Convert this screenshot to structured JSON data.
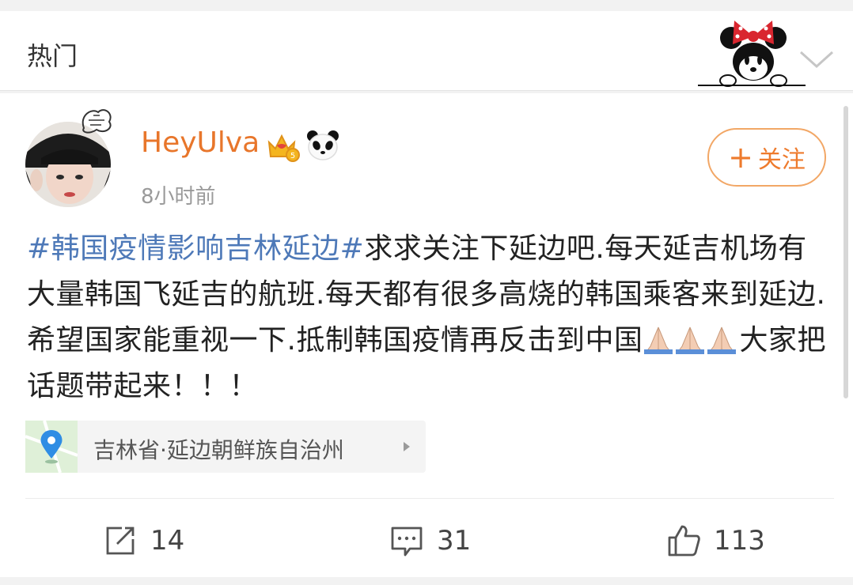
{
  "header": {
    "title": "热门"
  },
  "post": {
    "username": "HeyUlva",
    "time": "8小时前",
    "follow_label": "关注",
    "hashtag": "#韩国疫情影响吉林延边#",
    "body_part1": "求求关注下延边吧.每天延吉机场有大量韩国飞延吉的航班.每天都有很多高烧的韩国乘客来到延边.希望国家能重视一下.抵制韩国疫情再反击到中国",
    "body_part2": "大家把话题带起来！！！",
    "location": "吉林省·延边朝鲜族自治州",
    "reposts": "14",
    "comments": "31",
    "likes": "113"
  },
  "icons": {
    "crown_badge": "crown-badge-icon",
    "panda_badge": "panda-icon",
    "pray_emoji": "praying-hands-emoji",
    "location_pin": "location-pin-icon",
    "repost": "repost-icon",
    "comment": "comment-icon",
    "like": "thumbs-up-icon"
  },
  "colors": {
    "username": "#e8762b",
    "hashtag": "#4e79b8",
    "follow": "#ee7b2d",
    "location_pin": "#2f8de4"
  }
}
